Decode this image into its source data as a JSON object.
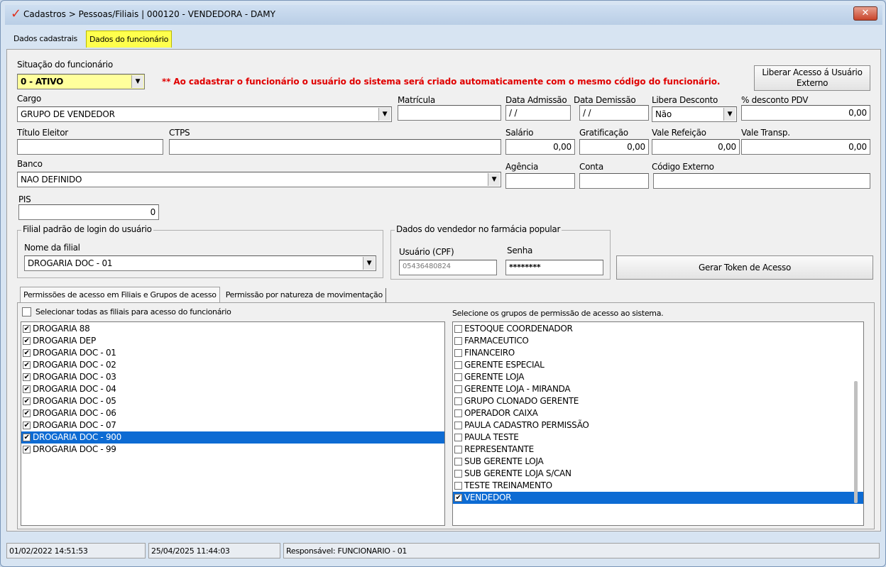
{
  "window": {
    "title": "Cadastros > Pessoas/Filiais | 000120 - VENDEDORA - DAMY",
    "close_glyph": "✕"
  },
  "tabs": [
    {
      "label": "Dados cadastrais"
    },
    {
      "label": "Dados do funcionário"
    }
  ],
  "form": {
    "situacao_label": "Situação do funcionário",
    "situacao_value": "0 - ATIVO",
    "warning": "** Ao cadastrar o funcionário o usuário do sistema será criado automaticamente com o mesmo código do funcionário.",
    "liberar_button": "Liberar Acesso á Usuário Externo",
    "cargo_label": "Cargo",
    "cargo_value": "GRUPO DE VENDEDOR",
    "matricula_label": "Matrícula",
    "matricula_value": "",
    "data_admissao_label": "Data Admissão",
    "data_admissao_value": " / /",
    "data_demissao_label": "Data Demissão",
    "data_demissao_value": " / /",
    "libera_desconto_label": "Libera Desconto",
    "libera_desconto_value": "Não",
    "desconto_pdv_label": "% desconto PDV",
    "desconto_pdv_value": "0,00",
    "titulo_eleitor_label": "Título Eleitor",
    "titulo_eleitor_value": "",
    "ctps_label": "CTPS",
    "ctps_value": "",
    "salario_label": "Salário",
    "salario_value": "0,00",
    "gratificacao_label": "Gratificação",
    "gratificacao_value": "0,00",
    "vale_refeicao_label": "Vale Refeição",
    "vale_refeicao_value": "0,00",
    "vale_transp_label": "Vale Transp.",
    "vale_transp_value": "0,00",
    "banco_label": "Banco",
    "banco_value": "NAO DEFINIDO",
    "agencia_label": "Agência",
    "agencia_value": "",
    "conta_label": "Conta",
    "conta_value": "",
    "codigo_externo_label": "Código Externo",
    "codigo_externo_value": "",
    "pis_label": "PIS",
    "pis_value": "0",
    "filial_group_title": "Filial padrão de login do usuário",
    "nome_filial_label": "Nome da filial",
    "nome_filial_value": "DROGARIA DOC - 01",
    "vendedor_group_title": "Dados do vendedor no farmácia popular",
    "usuario_cpf_label": "Usuário (CPF)",
    "usuario_cpf_value": "05436480824",
    "senha_label": "Senha",
    "senha_value": "********",
    "gerar_token_button": "Gerar Token de Acesso"
  },
  "sub_tabs": [
    {
      "label": "Permissões de acesso em Filiais e Grupos de acesso"
    },
    {
      "label": "Permissão por natureza de movimentação"
    }
  ],
  "filiais": {
    "select_all_label": "Selecionar todas as filiais para acesso do funcionário",
    "items": [
      {
        "label": "DROGARIA 88",
        "checked": "✔"
      },
      {
        "label": "DROGARIA DEP",
        "checked": "✔"
      },
      {
        "label": "DROGARIA DOC - 01",
        "checked": "✔"
      },
      {
        "label": "DROGARIA DOC - 02",
        "checked": "✔"
      },
      {
        "label": "DROGARIA DOC - 03",
        "checked": "✔"
      },
      {
        "label": "DROGARIA DOC - 04",
        "checked": "✔"
      },
      {
        "label": "DROGARIA DOC - 05",
        "checked": "✔"
      },
      {
        "label": "DROGARIA DOC - 06",
        "checked": "✔"
      },
      {
        "label": "DROGARIA DOC - 07",
        "checked": "✔"
      },
      {
        "label": "DROGARIA DOC - 900",
        "checked": "✔"
      },
      {
        "label": "DROGARIA DOC - 99",
        "checked": "✔"
      }
    ]
  },
  "grupos": {
    "header": "Selecione os grupos de permissão de acesso ao sistema.",
    "items": [
      {
        "label": "ESTOQUE COORDENADOR",
        "checked": ""
      },
      {
        "label": "FARMACEUTICO",
        "checked": ""
      },
      {
        "label": "FINANCEIRO",
        "checked": ""
      },
      {
        "label": "GERENTE ESPECIAL",
        "checked": ""
      },
      {
        "label": "GERENTE LOJA",
        "checked": ""
      },
      {
        "label": "GERENTE LOJA - MIRANDA",
        "checked": ""
      },
      {
        "label": "GRUPO CLONADO GERENTE",
        "checked": ""
      },
      {
        "label": "OPERADOR CAIXA",
        "checked": ""
      },
      {
        "label": "PAULA CADASTRO PERMISSÃO",
        "checked": ""
      },
      {
        "label": "PAULA TESTE",
        "checked": ""
      },
      {
        "label": "REPRESENTANTE",
        "checked": ""
      },
      {
        "label": "SUB GERENTE LOJA",
        "checked": ""
      },
      {
        "label": "SUB GERENTE LOJA S/CAN",
        "checked": ""
      },
      {
        "label": "TESTE TREINAMENTO",
        "checked": ""
      },
      {
        "label": "VENDEDOR",
        "checked": "✔"
      }
    ]
  },
  "status": {
    "created": "01/02/2022 14:51:53",
    "modified": "25/04/2025 11:44:03",
    "responsavel": "Responsável: FUNCIONARIO - 01"
  },
  "glyphs": {
    "dropdown": "▼",
    "check": "✔"
  },
  "colors": {
    "accent": "#ffff4d",
    "selection": "#0d6bd3",
    "warning": "#e00000"
  }
}
